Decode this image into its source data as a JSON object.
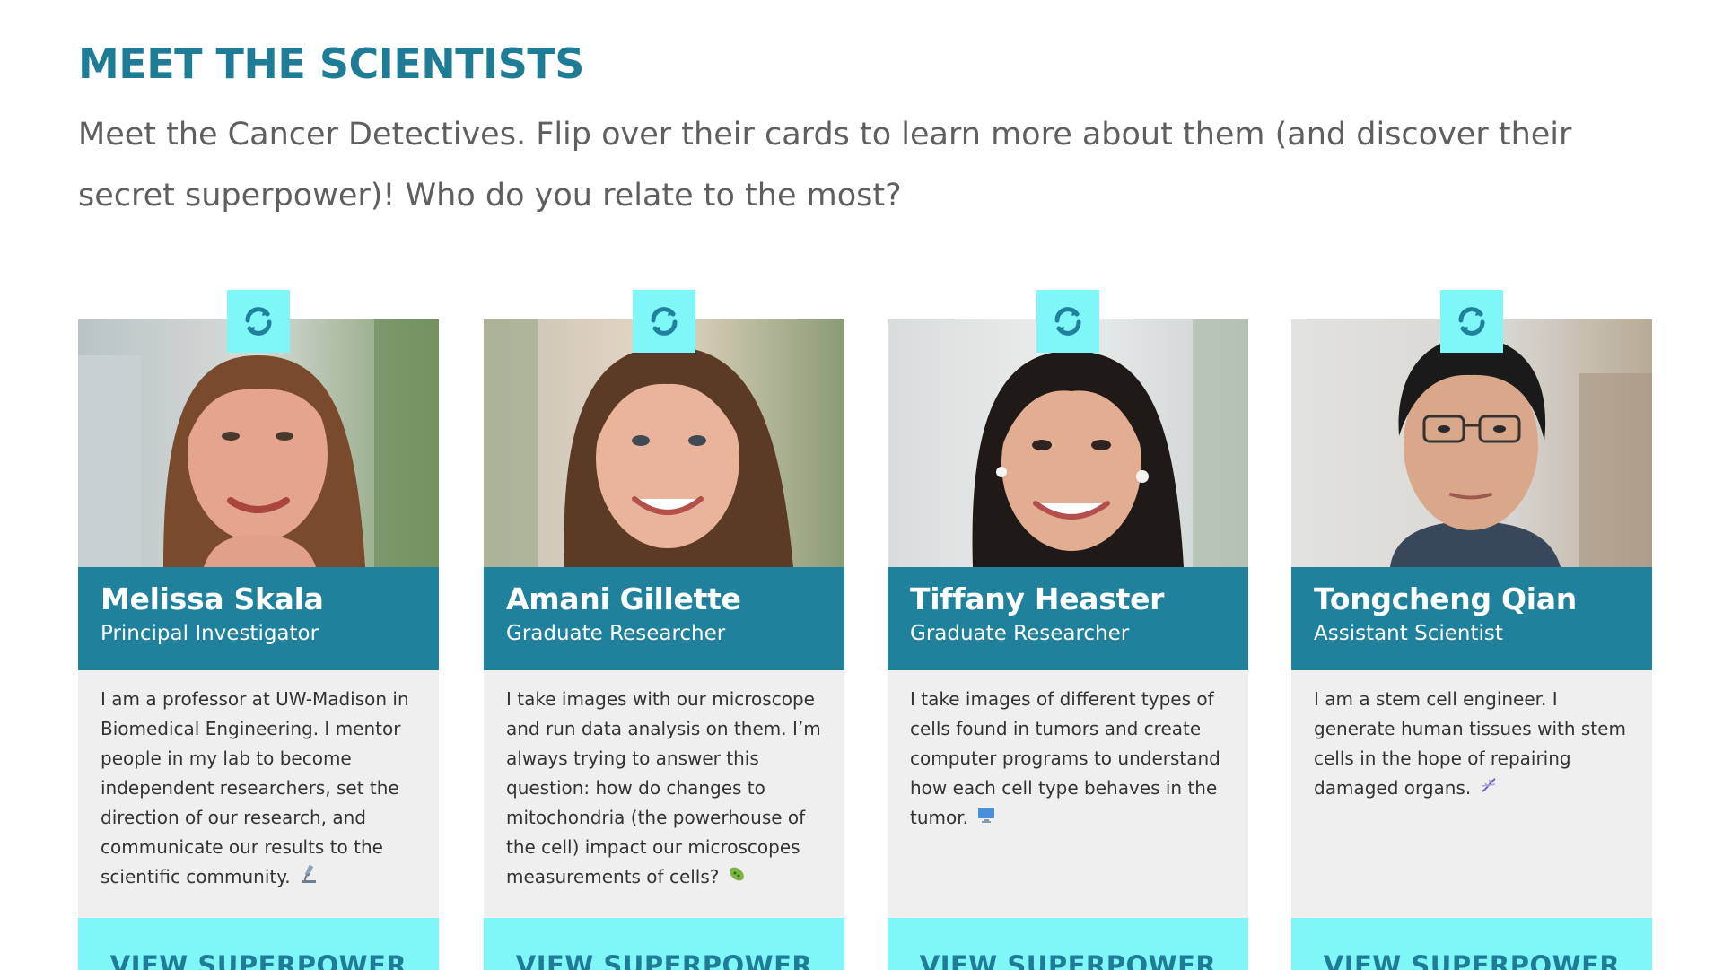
{
  "page": {
    "title": "MEET THE SCIENTISTS",
    "intro": "Meet the Cancer Detectives. Flip over their cards to learn more about them (and discover their secret superpower)! Who do you relate to the most?"
  },
  "colors": {
    "accent": "#1f7c96",
    "card_header": "#20819c",
    "flip_button": "#7ff7f9",
    "card_body": "#efefef"
  },
  "cards": [
    {
      "name": "Melissa Skala",
      "role": "Principal Investigator",
      "bio": "I am a professor at UW-Madison in Biomedical Engineering. I mentor people in my lab to become independent researchers, set the direction of our research, and communicate our results to the scientific community.",
      "emoji_icon": "microscope-icon",
      "flip_icon": "refresh-icon",
      "button_label": "VIEW SUPERPOWER"
    },
    {
      "name": "Amani Gillette",
      "role": "Graduate Researcher",
      "bio": "I take images with our microscope and run data analysis on them. I’m always trying to answer this question: how do changes to mitochondria (the powerhouse of the cell) impact our microscopes measurements of cells?",
      "emoji_icon": "microbe-icon",
      "flip_icon": "refresh-icon",
      "button_label": "VIEW SUPERPOWER"
    },
    {
      "name": "Tiffany Heaster",
      "role": "Graduate Researcher",
      "bio": "I take images of different types of cells found in tumors and create computer programs to understand how each cell type behaves in the tumor.",
      "emoji_icon": "computer-icon",
      "flip_icon": "refresh-icon",
      "button_label": "VIEW SUPERPOWER"
    },
    {
      "name": "Tongcheng Qian",
      "role": "Assistant Scientist",
      "bio": "I am a stem cell engineer. I generate human tissues with stem cells in the hope of repairing damaged organs.",
      "emoji_icon": "dna-icon",
      "flip_icon": "refresh-icon",
      "button_label": "VIEW SUPERPOWER"
    }
  ]
}
